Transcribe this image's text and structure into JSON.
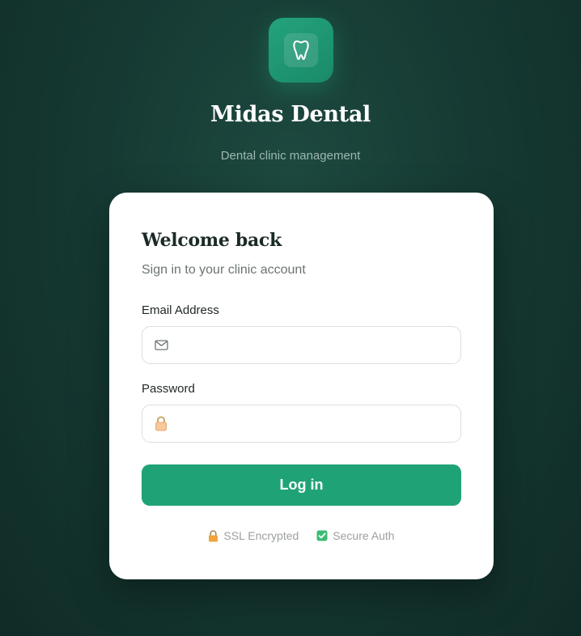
{
  "brand": {
    "name": "Midas Dental",
    "tagline": "Dental clinic management",
    "logo_icon": "tooth-icon",
    "accent_color": "#1fa376"
  },
  "login": {
    "title": "Welcome back",
    "subtitle": "Sign in to your clinic account",
    "email": {
      "label": "Email Address",
      "value": "",
      "placeholder": "",
      "icon": "mail-icon"
    },
    "password": {
      "label": "Password",
      "value": "",
      "placeholder": "",
      "icon": "lock-icon"
    },
    "submit_label": "Log in"
  },
  "footer": {
    "ssl_label": "SSL Encrypted",
    "ssl_icon": "lock-icon",
    "auth_label": "Secure Auth",
    "auth_icon": "check-icon"
  }
}
